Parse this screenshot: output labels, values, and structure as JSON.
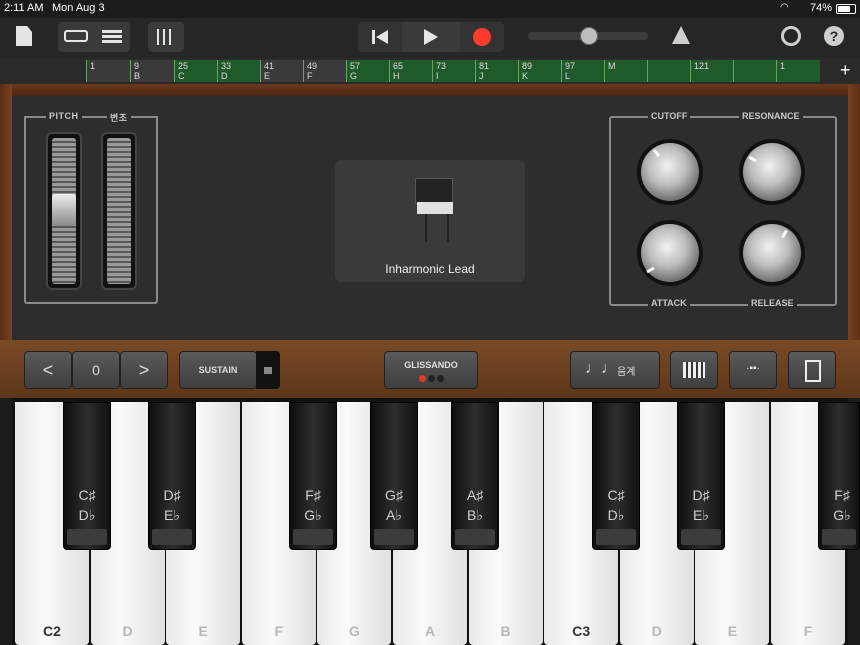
{
  "status": {
    "time": "2:11 AM",
    "date": "Mon Aug 3",
    "battery": "74%"
  },
  "toolbar": {
    "icons": [
      "document-icon",
      "browser-view-icon",
      "tracks-view-icon",
      "mixer-icon",
      "go-to-beginning-icon",
      "play-icon",
      "record-icon",
      "volume-slider",
      "metronome-icon",
      "settings-icon",
      "help-icon"
    ],
    "record_color": "#ff3b30",
    "help_label": "?"
  },
  "ruler": {
    "markers": [
      "1",
      "9",
      "B",
      "25",
      "C",
      "33",
      "D",
      "41",
      "E",
      "49",
      "F",
      "57",
      "G",
      "65",
      "H",
      "73",
      "I",
      "81",
      "J",
      "89",
      "K",
      "97",
      "L",
      "M",
      "121",
      "1"
    ],
    "add_label": "+"
  },
  "instrument": {
    "name": "Inharmonic Lead"
  },
  "wheels": {
    "pitch_label": "PITCH",
    "mod_label": "변조"
  },
  "knobs": {
    "cutoff": "CUTOFF",
    "resonance": "RESONANCE",
    "attack": "ATTACK",
    "release": "RELEASE"
  },
  "controls": {
    "octave_down": "<",
    "octave_value": "0",
    "octave_up": ">",
    "sustain": "SUSTAIN",
    "glissando": "GLISSANDO",
    "scale": "음계",
    "scale_icon": "music-note-icon"
  },
  "keyboard": {
    "white_keys": [
      "C2",
      "D",
      "E",
      "F",
      "G",
      "A",
      "B",
      "C3",
      "D",
      "E",
      "F"
    ],
    "black_keys": [
      "C♯\nD♭",
      "D♯\nE♭",
      "F♯\nG♭",
      "G♯\nA♭",
      "A♯\nB♭",
      "C♯\nD♭",
      "D♯\nE♭",
      "F♯\nG♭"
    ]
  },
  "colors": {
    "accent_green": "#1f5a2a",
    "wood": "#6b3a1e",
    "panel": "#2d2d2d"
  }
}
